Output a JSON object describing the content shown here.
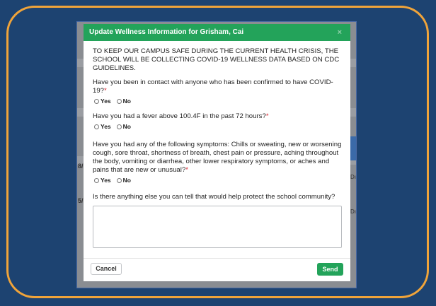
{
  "modal": {
    "title": "Update Wellness Information for Grisham, Cai",
    "close": "×",
    "intro": "TO KEEP OUR CAMPUS SAFE DURING THE CURRENT HEALTH CRISIS, THE SCHOOL WILL BE COLLECTING COVID-19 WELLNESS DATA BASED ON CDC GUIDELINES.",
    "questions": [
      {
        "text": "Have you been in contact with anyone who has been confirmed to have COVID-19?",
        "required": "*",
        "yes": "Yes",
        "no": "No"
      },
      {
        "text": "Have you had a fever above 100.4F in the past 72 hours?",
        "required": "*",
        "yes": "Yes",
        "no": "No"
      },
      {
        "text": "Have you had any of the following symptoms: Chills or sweating, new or worsening cough, sore throat, shortness of breath, chest pain or pressure, aching throughout the body, vomiting or diarrhea, other lower respiratory symptoms, or aches and pains that are new or unusual?",
        "required": "*",
        "yes": "Yes",
        "no": "No"
      }
    ],
    "notes_question": "Is there anything else you can tell that would help protect the school community?",
    "notes_value": "",
    "cancel_label": "Cancel",
    "send_label": "Send"
  },
  "background": {
    "left_fragment_1": "8/",
    "left_fragment_2": "5/",
    "right_fragment_1": "Dı",
    "right_fragment_2": "Dı"
  },
  "colors": {
    "frame": "#f0a43a",
    "page_bg": "#1d4371",
    "accent": "#23a35a",
    "required": "#d9232e"
  }
}
